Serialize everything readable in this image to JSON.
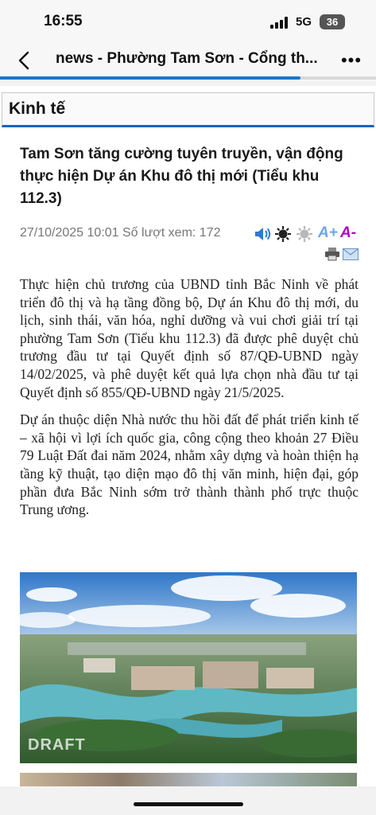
{
  "status_bar": {
    "time": "16:55",
    "network": "5G",
    "battery": "36"
  },
  "nav_bar": {
    "title": "news - Phường Tam Sơn - Cổng th...",
    "load_progress": 0.8
  },
  "section": {
    "title": "Kinh tế"
  },
  "article": {
    "headline": "Tam Sơn tăng cường tuyên truyền, vận động thực hiện Dự án Khu đô thị mới (Tiểu khu 112.3)",
    "meta": "27/10/2025 10:01 Số lượt xem: 172",
    "paragraphs": [
      "Thực hiện chủ trương của UBND tỉnh Bắc Ninh về phát triển đô thị và hạ tầng đồng bộ, Dự án Khu đô thị mới, du lịch, sinh thái, văn hóa, nghỉ dưỡng và vui chơi giải trí tại phường Tam Sơn (Tiểu khu 112.3) đã được phê duyệt chủ trương đầu tư tại Quyết định số 87/QĐ-UBND ngày 14/02/2025, và phê duyệt kết quả lựa chọn nhà đầu tư tại Quyết định số 855/QĐ-UBND ngày 21/5/2025.",
      "Dự án thuộc diện Nhà nước thu hồi đất để phát triển kinh tế – xã hội vì lợi ích quốc gia, công cộng theo khoản 27 Điều 79 Luật Đất đai năm 2024, nhằm xây dựng và hoàn thiện hạ tầng kỹ thuật, tạo diện mạo đô thị văn minh, hiện đại, góp phần đưa Bắc Ninh sớm trở thành thành phố trực thuộc Trung ương."
    ],
    "image_watermark": "DRAFT",
    "tools": {
      "font_increase": "A+",
      "font_decrease": "A-"
    }
  },
  "colors": {
    "accent": "#1565c0",
    "progress": "#1976d2",
    "tool_blue": "#2b7bd6",
    "tool_purple": "#b000c8"
  },
  "icons": [
    "back-arrow-icon",
    "more-icon",
    "speaker-icon",
    "brightness-dark-icon",
    "brightness-light-icon",
    "print-icon",
    "email-icon"
  ]
}
